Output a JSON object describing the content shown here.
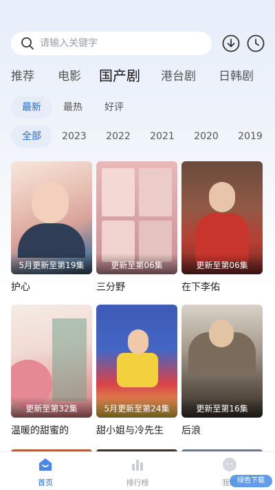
{
  "search": {
    "placeholder": "请输入关键字"
  },
  "category_tabs": [
    {
      "label": "推荐"
    },
    {
      "label": "电影"
    },
    {
      "label": "国产剧",
      "active": true
    },
    {
      "label": "港台剧"
    },
    {
      "label": "日韩剧"
    }
  ],
  "sort_tabs": [
    {
      "label": "最新",
      "active": true
    },
    {
      "label": "最热"
    },
    {
      "label": "好评"
    }
  ],
  "year_tabs": [
    {
      "label": "全部",
      "active": true
    },
    {
      "label": "2023"
    },
    {
      "label": "2022"
    },
    {
      "label": "2021"
    },
    {
      "label": "2020"
    },
    {
      "label": "2019"
    }
  ],
  "shows": [
    {
      "title": "护心",
      "episode_text": "5月更新至第19集"
    },
    {
      "title": "三分野",
      "episode_text": "更新至第06集"
    },
    {
      "title": "在下李佑",
      "episode_text": "更新至第06集"
    },
    {
      "title": "温暖的甜蜜的",
      "episode_text": "更新至第32集"
    },
    {
      "title": "甜小姐与冷先生",
      "episode_text": "5月更新至第24集"
    },
    {
      "title": "后浪",
      "episode_text": "更新至第16集"
    }
  ],
  "bottom_nav": [
    {
      "label": "首页",
      "active": true
    },
    {
      "label": "排行榜"
    },
    {
      "label": "我的"
    }
  ],
  "watermark": "绿色下载",
  "colors": {
    "accent": "#2a66d8",
    "pill_bg": "#e6edf9"
  }
}
